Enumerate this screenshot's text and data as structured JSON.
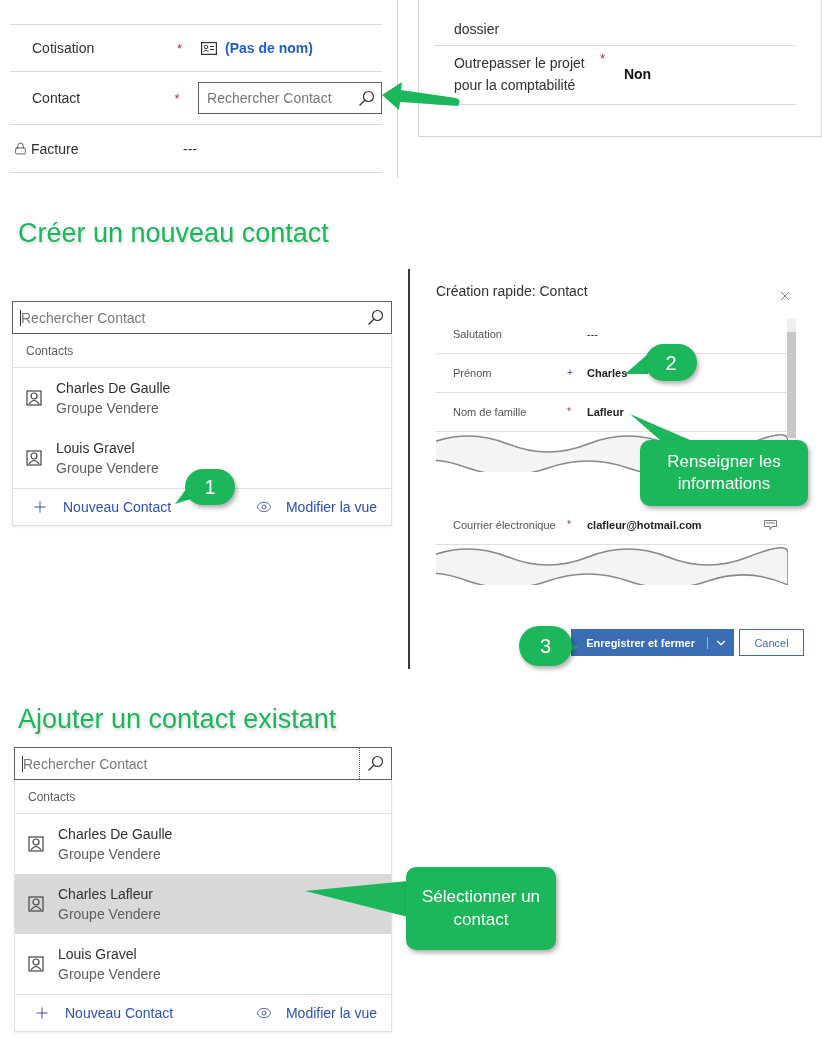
{
  "record_form": {
    "rows": [
      {
        "label": "Cotisation",
        "mark": {
          "text": "*",
          "kind": "required"
        },
        "locked": false,
        "kind": "lookup",
        "value": "(Pas de nom)"
      },
      {
        "label": "Contact",
        "mark": {
          "text": "*",
          "kind": "required"
        },
        "locked": false,
        "kind": "search",
        "placeholder": "Rechercher Contact"
      },
      {
        "label": "Facture",
        "locked": true,
        "kind": "text",
        "value": "---"
      }
    ]
  },
  "side_panel": {
    "rows": [
      {
        "label": "dossier"
      },
      {
        "label": "Outrepasser le projet pour la comptabilité",
        "mark": {
          "text": "*",
          "kind": "required"
        },
        "value": "Non"
      }
    ]
  },
  "new_contact": {
    "heading": "Créer un nouveau contact",
    "lookup": {
      "placeholder": "Rechercher Contact",
      "group_label": "Contacts",
      "results": [
        {
          "name": "Charles De Gaulle",
          "account": "Groupe Vendere",
          "selected": false
        },
        {
          "name": "Louis Gravel",
          "account": "Groupe Vendere",
          "selected": false
        }
      ],
      "new_label": "Nouveau Contact",
      "view_label": "Modifier la vue"
    },
    "quick_create": {
      "title": "Création rapide: Contact",
      "fields": [
        {
          "kind": "text",
          "label": "Salutation",
          "value": "---"
        },
        {
          "kind": "text",
          "label": "Prénom",
          "mark": {
            "text": "+",
            "kind": "recommended"
          },
          "value": "Charles"
        },
        {
          "kind": "text",
          "label": "Nom de famille",
          "mark": {
            "text": "*",
            "kind": "required"
          },
          "value": "Lafleur"
        },
        {
          "kind": "tear"
        },
        {
          "kind": "email",
          "label": "Courrier électronique",
          "mark": {
            "text": "*",
            "kind": "required"
          },
          "value": "clafleur@hotmail.com"
        },
        {
          "kind": "tear"
        }
      ],
      "save_label": "Enregistrer et fermer",
      "cancel_label": "Cancel"
    },
    "callouts": [
      {
        "kind": "step",
        "text": "1"
      },
      {
        "kind": "step",
        "text": "2"
      },
      {
        "kind": "note",
        "text": "Renseigner les informations"
      },
      {
        "kind": "step",
        "text": "3"
      }
    ]
  },
  "existing_contact": {
    "heading": "Ajouter un contact existant",
    "lookup": {
      "placeholder": "Rechercher Contact",
      "group_label": "Contacts",
      "results": [
        {
          "name": "Charles De Gaulle",
          "account": "Groupe Vendere",
          "selected": false
        },
        {
          "name": "Charles Lafleur",
          "account": "Groupe Vendere",
          "selected": true
        },
        {
          "name": "Louis Gravel",
          "account": "Groupe Vendere",
          "selected": false
        }
      ],
      "new_label": "Nouveau Contact",
      "view_label": "Modifier la vue"
    },
    "callouts": [
      {
        "kind": "note",
        "text": "Sélectionner un contact"
      }
    ]
  }
}
